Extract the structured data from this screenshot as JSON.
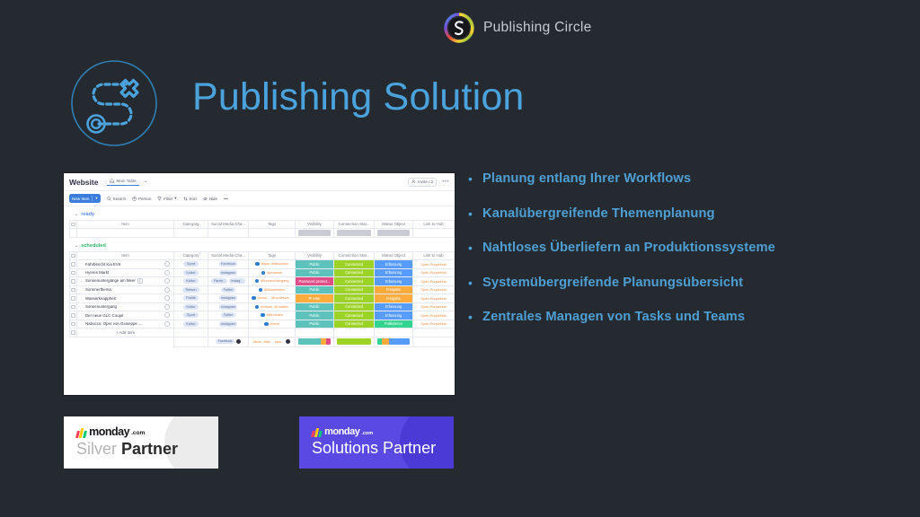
{
  "brand": {
    "name": "Publishing Circle",
    "logo_icon": "publishing-circle-logo",
    "ring_colors": [
      "#e8443a",
      "#f0a02a",
      "#f3d634",
      "#49b94a",
      "#2b9fe0",
      "#7a4ed8",
      "#e8443a"
    ]
  },
  "header": {
    "title": "Publishing Solution",
    "title_color": "#4ba3dd",
    "icon": "route-journey-icon"
  },
  "bullets": [
    {
      "marker": "•",
      "text": "Planung entlang Ihrer Workflows"
    },
    {
      "marker": "•",
      "text": "Kanalübergreifende Themenplanung"
    },
    {
      "marker": "•",
      "text": "Nahtloses Überliefern an Produktionssysteme"
    },
    {
      "marker": "•",
      "text": "Systemübergreifende Planungsübersicht"
    },
    {
      "marker": "•",
      "text": "Zentrales Managen von Tasks und Teams"
    }
  ],
  "screenshot": {
    "board_title": "Website",
    "tab_label": "Main Table",
    "tab_icon": "home-icon",
    "tab_add": "+",
    "invite_label": "Invite / 2",
    "invite_icon": "person-icon",
    "more_menu": "•••",
    "toolbar": {
      "new_item": "New Item",
      "new_item_caret": "▾",
      "search": "Search",
      "person": "Person",
      "filter": "Filter",
      "filter_caret": "▾",
      "sort": "Sort",
      "hide": "Hide",
      "more": "•••"
    },
    "columns": [
      "Item",
      "Category",
      "Social Media Cha...",
      "Tags",
      "Visibility",
      "Connection Stat...",
      "Status Object",
      "Link to Hub"
    ],
    "groups": [
      {
        "name": "ready",
        "color": "#5b8ff9",
        "caret": "⌄",
        "rows": []
      },
      {
        "name": "scheduled",
        "color": "#2fb567",
        "caret": "⌄",
        "rows": [
          {
            "item": "Fahrbericht Kia EV9",
            "expand": "",
            "badge": "",
            "category": "Sport",
            "social": [
              "Facebook"
            ],
            "tags": [
              "#Auto",
              "#Mercedes"
            ],
            "visibility": "Public",
            "visibility_color": "#5cc2bb",
            "connection": "Connected",
            "connection_color": "#9cd326",
            "status": "Erfassung",
            "status_color": "#579bfc",
            "hub": "Open-PurpleHub"
          },
          {
            "item": "Hyeres Markt",
            "expand": "",
            "badge": "",
            "category": "Kultur",
            "social": [
              "Instagram"
            ],
            "tags": [
              "#provence"
            ],
            "visibility": "Public",
            "visibility_color": "#5cc2bb",
            "connection": "Connected",
            "connection_color": "#9cd326",
            "status": "Erfassung",
            "status_color": "#579bfc",
            "hub": "Open-PurpleHub"
          },
          {
            "item": "Sonnenuntergänge am Meer",
            "expand": "›",
            "badge": "1",
            "category": "Kultur",
            "social": [
              "Faceb...",
              "Instag..."
            ],
            "tags": [
              "#Sonnenuntergang"
            ],
            "visibility": "Password protect...",
            "visibility_color": "#df4d87",
            "connection": "Connected",
            "connection_color": "#9cd326",
            "status": "Erfassung",
            "status_color": "#579bfc",
            "hub": "Open-PurpleHub"
          },
          {
            "item": "Sommerthema",
            "expand": "",
            "badge": "",
            "category": "Reisen",
            "social": [
              "Twitter"
            ],
            "tags": [
              "#Wasserwerte"
            ],
            "visibility": "Public",
            "visibility_color": "#5cc2bb",
            "connection": "Connected",
            "connection_color": "#9cd326",
            "status": "Freigabe",
            "status_color": "#fdab3d",
            "hub": "Open-PurpleHub"
          },
          {
            "item": "Wasserknappheit",
            "expand": "",
            "badge": "",
            "category": "Politik",
            "social": [
              "Instagram"
            ],
            "tags": [
              "#Vorsl...",
              "#Bundesver..."
            ],
            "visibility": "Private",
            "visibility_color": "#fdab3d",
            "connection": "Connected",
            "connection_color": "#9cd326",
            "status": "Freigabe",
            "status_color": "#fdab3d",
            "hub": "Open-PurpleHub"
          },
          {
            "item": "Sonnenuntergang",
            "expand": "",
            "badge": "",
            "category": "Kultur",
            "social": [
              "Instagram"
            ],
            "tags": [
              "#Urlaub",
              "#Kroatien"
            ],
            "visibility": "Public",
            "visibility_color": "#5cc2bb",
            "connection": "Connected",
            "connection_color": "#9cd326",
            "status": "Erfassung",
            "status_color": "#579bfc",
            "hub": "Open-PurpleHub"
          },
          {
            "item": "Der neue GLC Coupé",
            "expand": "",
            "badge": "",
            "category": "Sport",
            "social": [
              "Twitter"
            ],
            "tags": [
              "#Mercedes"
            ],
            "visibility": "Public",
            "visibility_color": "#5cc2bb",
            "connection": "Connected",
            "connection_color": "#9cd326",
            "status": "Erfassung",
            "status_color": "#579bfc",
            "hub": "Open-PurpleHub"
          },
          {
            "item": "Nabucco: Oper von Giuseppe ...",
            "expand": "",
            "badge": "",
            "category": "Kultur",
            "social": [
              "Instagram"
            ],
            "tags": [
              "#verdi"
            ],
            "visibility": "Public",
            "visibility_color": "#5cc2bb",
            "connection": "Connected",
            "connection_color": "#9cd326",
            "status": "Publizieren",
            "status_color": "#33d391",
            "hub": "Open-PurpleHub"
          }
        ]
      }
    ],
    "add_item": "+ Add Item",
    "summary": {
      "social_pill": "Facebook",
      "tag_sample": [
        "#Auto",
        "#Me...",
        "#pro..."
      ],
      "vis_bar": [
        {
          "color": "#5cc2bb",
          "pct": 70
        },
        {
          "color": "#fdab3d",
          "pct": 15
        },
        {
          "color": "#df4d87",
          "pct": 15
        }
      ],
      "con_bar": [
        {
          "color": "#9cd326",
          "pct": 100
        }
      ],
      "sta_bar": [
        {
          "color": "#33d391",
          "pct": 14
        },
        {
          "color": "#fdab3d",
          "pct": 22
        },
        {
          "color": "#579bfc",
          "pct": 64
        }
      ]
    }
  },
  "partners": [
    {
      "id": "silver",
      "brand_word": "monday",
      "brand_suffix": ".com",
      "label_light": "Silver",
      "label_bold": "Partner",
      "bg": "#ffffff"
    },
    {
      "id": "solutions",
      "brand_word": "monday",
      "brand_suffix": ".com",
      "label": "Solutions Partner",
      "bg": "#5a4ae3"
    }
  ]
}
